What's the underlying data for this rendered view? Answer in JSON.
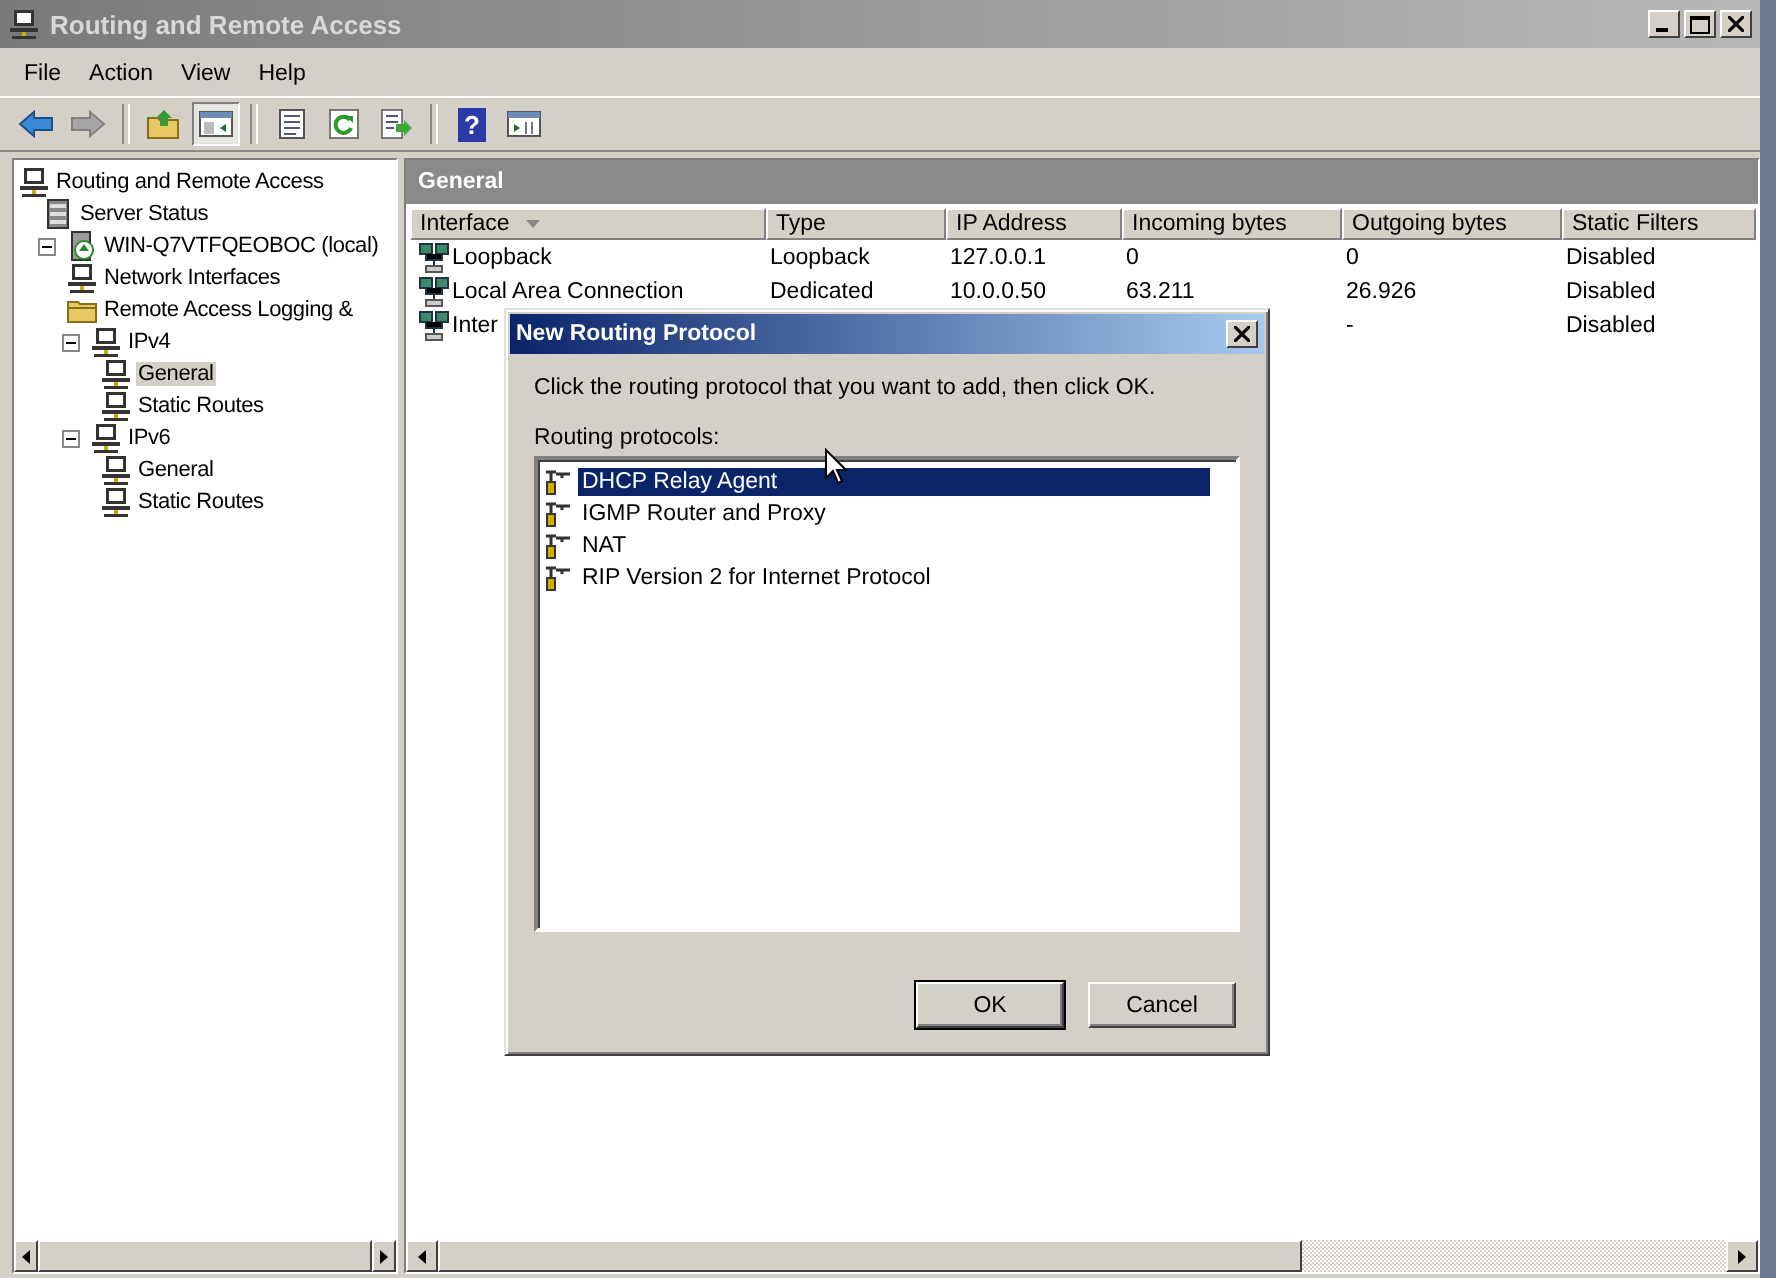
{
  "window": {
    "title": "Routing and Remote Access"
  },
  "menu": [
    "File",
    "Action",
    "View",
    "Help"
  ],
  "toolbar": [
    {
      "kind": "back",
      "disabled": false
    },
    {
      "kind": "forward",
      "disabled": true
    },
    {
      "kind": "up",
      "disabled": false
    },
    {
      "kind": "tree",
      "disabled": false,
      "pressed": true
    },
    {
      "kind": "properties",
      "disabled": false
    },
    {
      "kind": "refresh",
      "disabled": false
    },
    {
      "kind": "export",
      "disabled": false
    },
    {
      "kind": "help",
      "disabled": false,
      "label": "?"
    },
    {
      "kind": "console",
      "disabled": false
    }
  ],
  "tree": [
    {
      "label": "Routing and Remote Access",
      "kind": "computer",
      "selected": false,
      "children": [
        {
          "label": "Server Status",
          "kind": "server",
          "selected": false
        },
        {
          "label": "WIN-Q7VTFQEOBOC (local)",
          "kind": "server-up",
          "selected": false,
          "expanded": true,
          "children": [
            {
              "label": "Network Interfaces",
              "kind": "computer",
              "selected": false
            },
            {
              "label": "Remote Access Logging &",
              "kind": "folder",
              "selected": false
            },
            {
              "label": "IPv4",
              "kind": "computer",
              "selected": false,
              "expanded": true,
              "children": [
                {
                  "label": "General",
                  "kind": "computer",
                  "selected": true
                },
                {
                  "label": "Static Routes",
                  "kind": "computer",
                  "selected": false
                }
              ]
            },
            {
              "label": "IPv6",
              "kind": "computer",
              "selected": false,
              "expanded": true,
              "children": [
                {
                  "label": "General",
                  "kind": "computer",
                  "selected": false
                },
                {
                  "label": "Static Routes",
                  "kind": "computer",
                  "selected": false
                }
              ]
            }
          ]
        }
      ]
    }
  ],
  "pane": {
    "title": "General",
    "columns": [
      {
        "label": "Interface",
        "sorted": true
      },
      {
        "label": "Type",
        "sorted": false
      },
      {
        "label": "IP Address",
        "sorted": false
      },
      {
        "label": "Incoming bytes",
        "sorted": false
      },
      {
        "label": "Outgoing bytes",
        "sorted": false
      },
      {
        "label": "Static Filters",
        "sorted": false
      }
    ],
    "rows": [
      {
        "interface": "Loopback",
        "type": "Loopback",
        "ip_address": "127.0.0.1",
        "incoming_bytes": "0",
        "outgoing_bytes": "0",
        "static_filters": "Disabled"
      },
      {
        "interface": "Local Area Connection",
        "type": "Dedicated",
        "ip_address": "10.0.0.50",
        "incoming_bytes": "63.211",
        "outgoing_bytes": "26.926",
        "static_filters": "Disabled"
      },
      {
        "interface": "Inter",
        "outgoing_bytes": "-",
        "static_filters": "Disabled"
      }
    ]
  },
  "dialog": {
    "title": "New Routing Protocol",
    "instruction": "Click the routing protocol that you want to add, then click OK.",
    "list_label": "Routing protocols:",
    "protocols": [
      {
        "label": "DHCP Relay Agent",
        "selected": true
      },
      {
        "label": "IGMP Router and Proxy",
        "selected": false
      },
      {
        "label": "NAT",
        "selected": false
      },
      {
        "label": "RIP Version 2 for Internet Protocol",
        "selected": false
      }
    ],
    "buttons": [
      {
        "label": "OK",
        "default": true
      },
      {
        "label": "Cancel",
        "default": false
      }
    ]
  }
}
